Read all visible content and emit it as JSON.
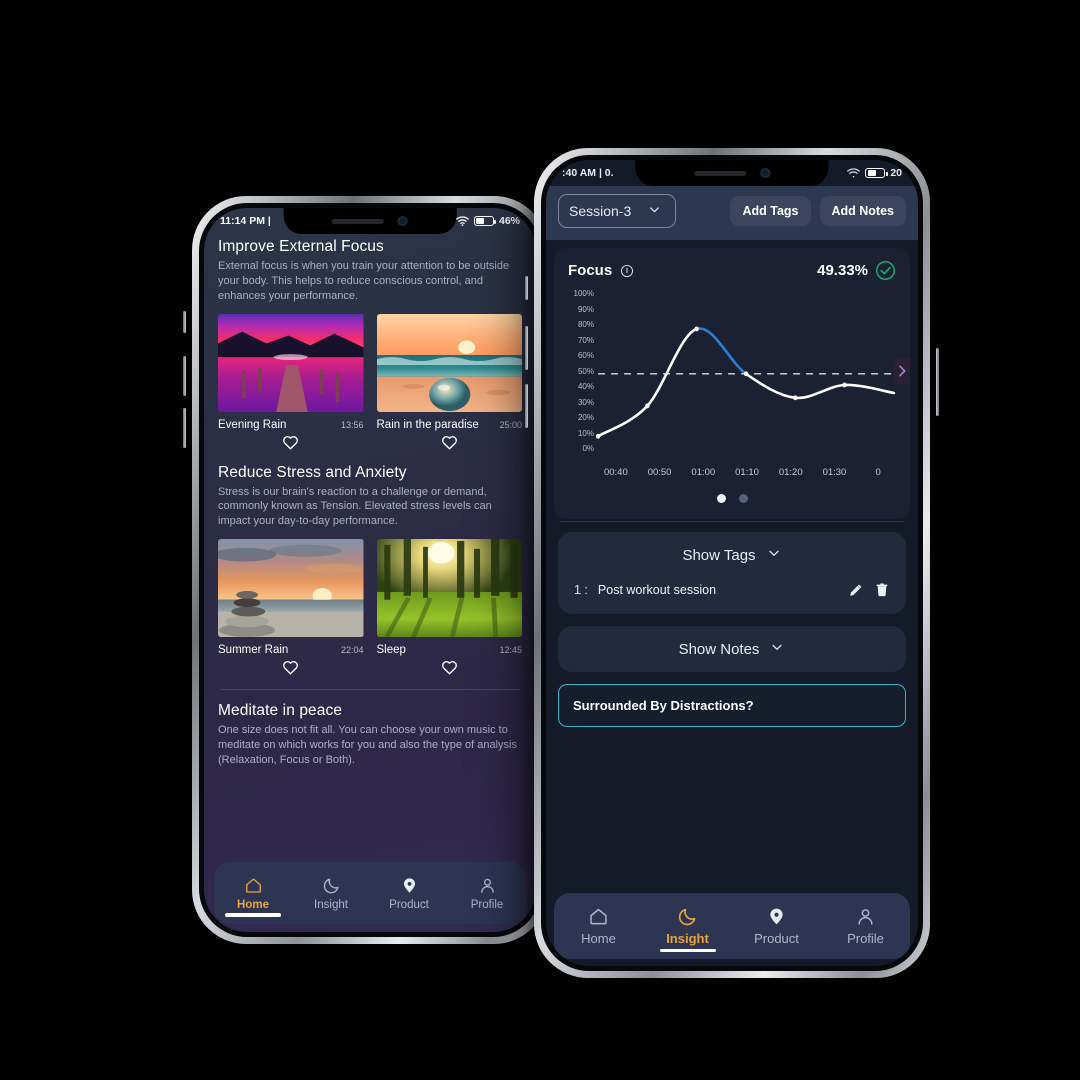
{
  "phone1": {
    "status": {
      "time": "11:14 PM |",
      "battery": "46%",
      "wifi_icon": "wifi-icon",
      "battery_icon": "battery-icon"
    },
    "sections": [
      {
        "title": "Improve External Focus",
        "desc": "External focus is when you train your attention to be outside your body. This helps to reduce conscious control, and enhances your performance.",
        "cards": [
          {
            "name": "Evening Rain",
            "time": "13:56",
            "image": "purple-pier-sunset"
          },
          {
            "name": "Rain in the paradise",
            "time": "25:00",
            "image": "ocean-sunset-sphere"
          }
        ]
      },
      {
        "title": "Reduce Stress and Anxiety",
        "desc": "Stress is our brain's reaction to a challenge or demand, commonly known as Tension. Elevated stress levels can impact your day-to-day performance.",
        "cards": [
          {
            "name": "Summer Rain",
            "time": "22:04",
            "image": "zen-stones-beach"
          },
          {
            "name": "Sleep",
            "time": "12:45",
            "image": "sunlit-forest"
          }
        ]
      }
    ],
    "footer": {
      "title": "Meditate in peace",
      "desc": "One size does not fit all. You can choose your own music to meditate on which works for you and also the type of analysis (Relaxation, Focus or Both)."
    },
    "tabs": [
      {
        "label": "Home",
        "icon": "home-icon",
        "active": true
      },
      {
        "label": "Insight",
        "icon": "moon-icon",
        "active": false
      },
      {
        "label": "Product",
        "icon": "product-icon",
        "active": false
      },
      {
        "label": "Profile",
        "icon": "person-icon",
        "active": false
      }
    ]
  },
  "phone2": {
    "status": {
      "time": ":40 AM | 0.",
      "battery": "20",
      "wifi_icon": "wifi-icon",
      "battery_icon": "battery-icon"
    },
    "toolbar": {
      "session": "Session-3",
      "session_chevron": "chevron-down-icon",
      "add_tags": "Add Tags",
      "add_notes": "Add Notes"
    },
    "metric": {
      "label": "Focus",
      "info_icon": "info-icon",
      "value": "49.33%",
      "status_icon": "check-circle-icon"
    },
    "pager": {
      "count": 2,
      "active": 0
    },
    "tags_panel": {
      "header": "Show Tags",
      "chevron": "chevron-down-icon",
      "rows": [
        {
          "index": "1 :",
          "text": "Post workout session",
          "edit_icon": "pencil-icon",
          "delete_icon": "trash-icon"
        }
      ]
    },
    "notes_panel": {
      "header": "Show Notes",
      "chevron": "chevron-down-icon"
    },
    "note_input": {
      "value": "Surrounded By Distractions?",
      "accent": "#2fb6c4"
    },
    "tabs": [
      {
        "label": "Home",
        "icon": "home-icon",
        "active": false
      },
      {
        "label": "Insight",
        "icon": "moon-icon",
        "active": true
      },
      {
        "label": "Product",
        "icon": "product-icon",
        "active": false
      },
      {
        "label": "Profile",
        "icon": "person-icon",
        "active": false
      }
    ]
  },
  "chart_data": {
    "type": "line",
    "title": "Focus",
    "xlabel": "",
    "ylabel": "",
    "x": [
      "00:40",
      "00:50",
      "01:00",
      "01:10",
      "01:20",
      "01:30",
      "0"
    ],
    "ytick_labels": [
      "100%",
      "90%",
      "80%",
      "70%",
      "60%",
      "50%",
      "40%",
      "30%",
      "20%",
      "10%",
      "0%"
    ],
    "ylim": [
      0,
      100
    ],
    "series": [
      {
        "name": "Focus",
        "values": [
          11,
          30,
          78,
          50,
          35,
          43,
          38
        ],
        "color": "#ffffff",
        "highlight_color": "#2a7fd4"
      }
    ],
    "threshold": {
      "value": 50,
      "style": "dashed",
      "color": "#d6dae6"
    },
    "grid": false,
    "legend": "none"
  },
  "theme": {
    "accent": "#e8a33d",
    "line": "#ffffff",
    "line_highlight": "#2a7fd4",
    "ok_green": "#21a66b",
    "input_accent": "#2fb6c4"
  }
}
